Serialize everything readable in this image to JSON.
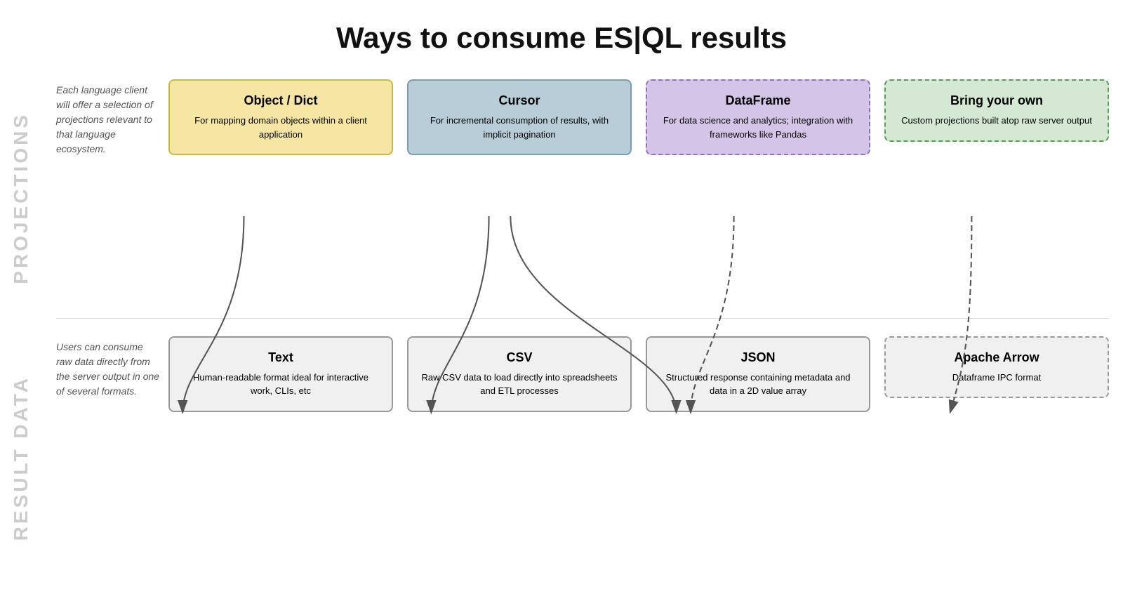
{
  "title": "Ways to consume ES|QL results",
  "sidebar": {
    "projections_label": "PROJECTIONS",
    "result_data_label": "RESULT DATA"
  },
  "projections_desc": "Each language client will offer a selection of projections relevant to that language ecosystem.",
  "result_desc": "Users can consume raw data directly from the server output in one of several formats.",
  "cards": {
    "object": {
      "title": "Object / Dict",
      "desc": "For mapping domain objects within a client application"
    },
    "cursor": {
      "title": "Cursor",
      "desc": "For incremental consumption of results, with implicit pagination"
    },
    "dataframe": {
      "title": "DataFrame",
      "desc": "For data science and analytics; integration with frameworks like Pandas"
    },
    "bringyourown": {
      "title": "Bring your own",
      "desc": "Custom projections built atop raw server output"
    },
    "text": {
      "title": "Text",
      "desc": "Human-readable format ideal for interactive work, CLIs, etc"
    },
    "csv": {
      "title": "CSV",
      "desc": "Raw CSV data to load directly into spreadsheets and ETL processes"
    },
    "json": {
      "title": "JSON",
      "desc": "Structured response containing metadata and data in a 2D value array"
    },
    "apache": {
      "title": "Apache Arrow",
      "desc": "Dataframe IPC format"
    }
  }
}
